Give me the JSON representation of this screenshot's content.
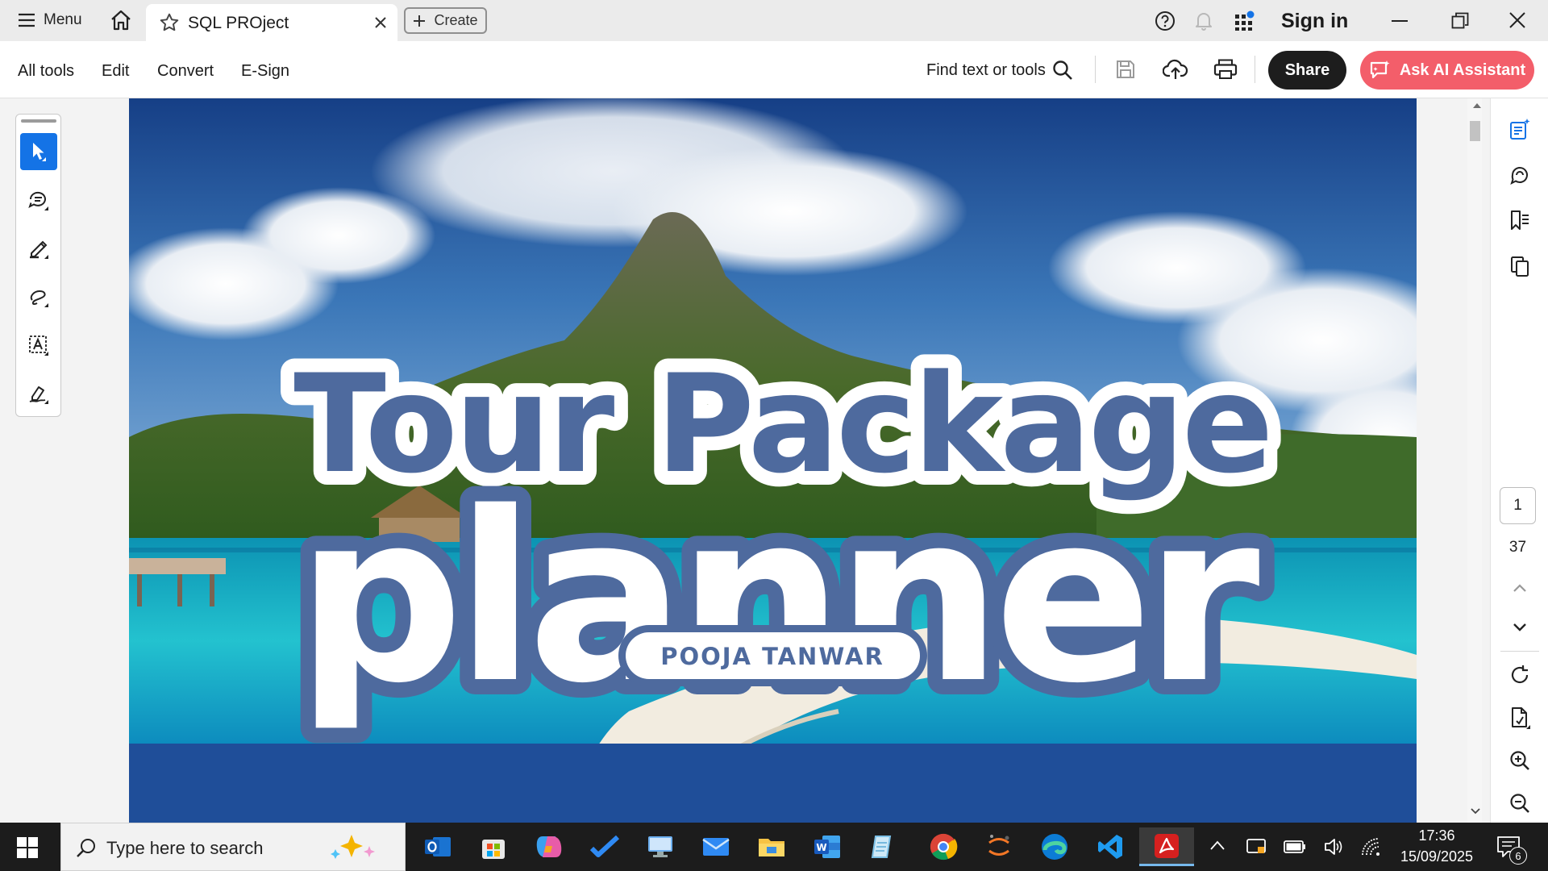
{
  "titlebar": {
    "menu_label": "Menu",
    "tab_title": "SQL PROject",
    "create_label": "Create",
    "signin_label": "Sign in"
  },
  "toolbar": {
    "items": [
      "All tools",
      "Edit",
      "Convert",
      "E-Sign"
    ],
    "find_label": "Find text or tools",
    "share_label": "Share",
    "ai_label": "Ask AI Assistant"
  },
  "document": {
    "title_line1": "Tour Package",
    "title_line2": "planner",
    "author": "POOJA TANWAR"
  },
  "pagination": {
    "current_page": "1",
    "total_pages": "37"
  },
  "taskbar": {
    "search_placeholder": "Type here to search",
    "time": "17:36",
    "date": "15/09/2025",
    "notification_count": "6"
  },
  "colors": {
    "accent_blue": "#1473e6",
    "share_bg": "#1d1d1d",
    "ai_button": "#f35e6a",
    "title_fill": "#4e6a9e",
    "page_bottom": "#1f4a92"
  }
}
